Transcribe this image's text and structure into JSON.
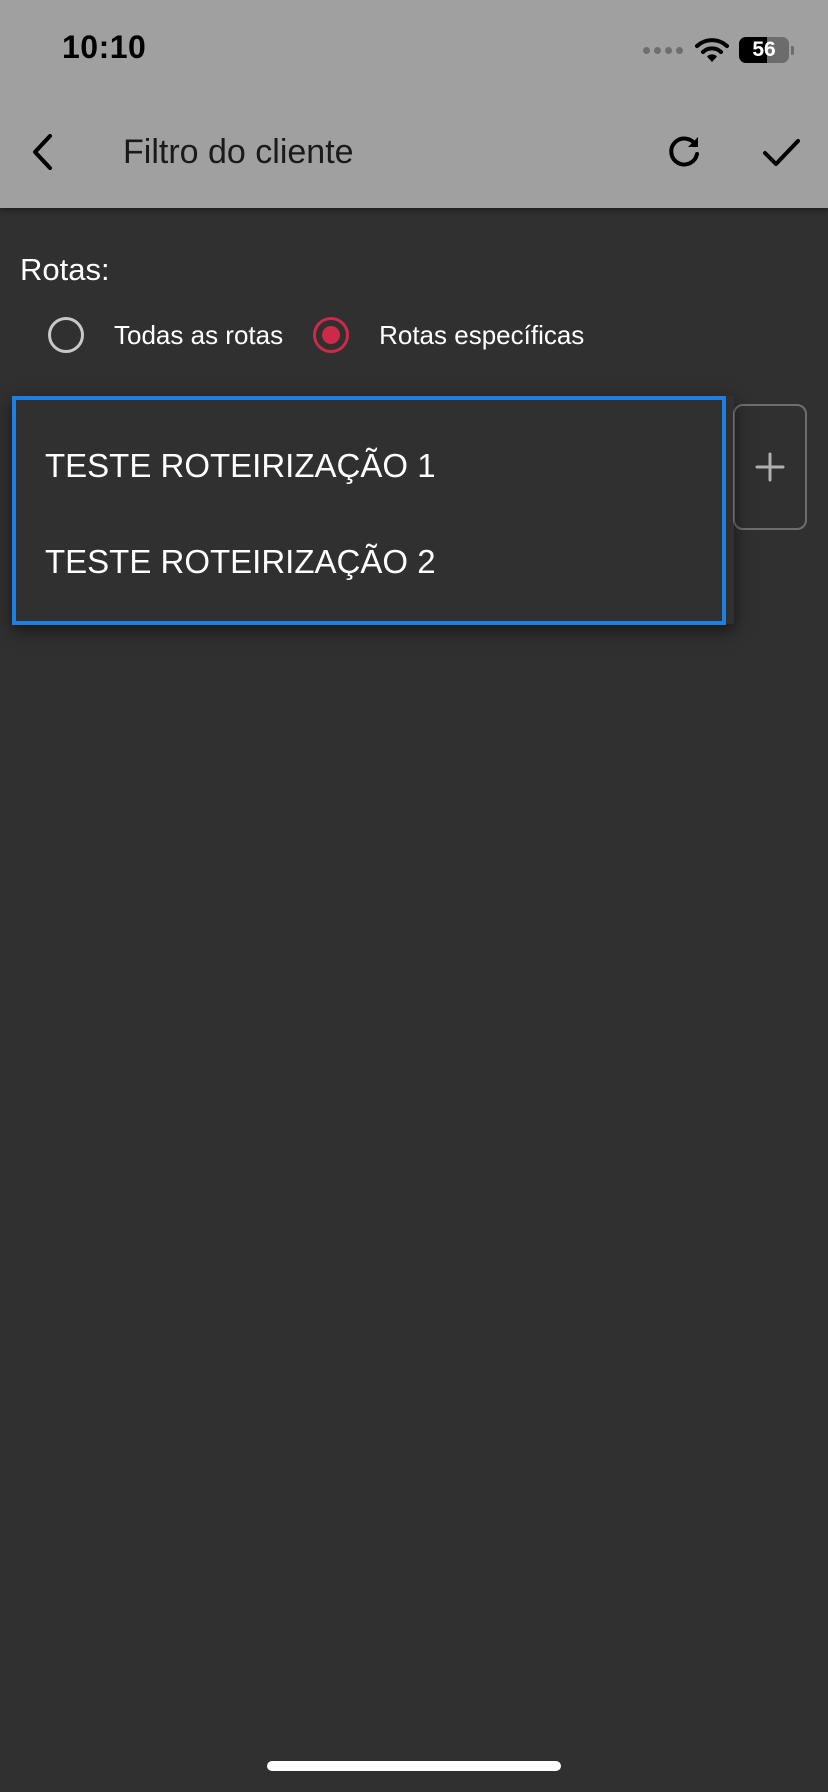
{
  "status_bar": {
    "time": "10:10",
    "battery_level": "56"
  },
  "toolbar": {
    "title": "Filtro do cliente",
    "back_icon": "chevron-left-icon",
    "refresh_icon": "refresh-icon",
    "confirm_icon": "check-icon"
  },
  "routes": {
    "label": "Rotas:",
    "options": [
      {
        "label": "Todas as rotas",
        "selected": false
      },
      {
        "label": "Rotas específicas",
        "selected": true
      }
    ],
    "add_icon": "plus-icon"
  },
  "dropdown": {
    "items": [
      "TESTE ROTEIRIZAÇÃO 1",
      "TESTE ROTEIRIZAÇÃO 2"
    ]
  },
  "colors": {
    "app_bar": "#a0a0a0",
    "background": "#303030",
    "accent": "#cc2a48",
    "dropdown_border": "#1f7fe0"
  }
}
